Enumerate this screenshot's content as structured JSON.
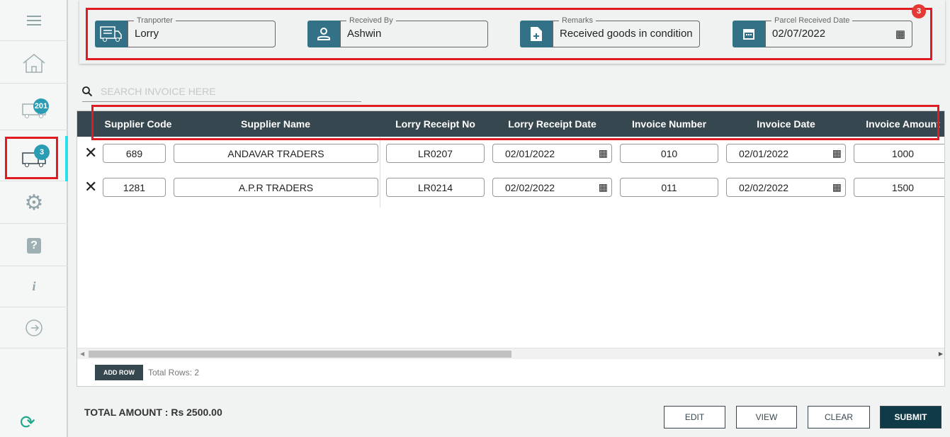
{
  "sidebar": {
    "in_transit_badge": "201",
    "received_badge": "3"
  },
  "header": {
    "notification_badge": "3",
    "fields": [
      {
        "label": "Tranporter",
        "value": "Lorry",
        "icon": "truck-icon"
      },
      {
        "label": "Received By",
        "value": "Ashwin",
        "icon": "person-icon"
      },
      {
        "label": "Remarks",
        "value": "Received goods in condition",
        "icon": "document-add-icon"
      },
      {
        "label": "Parcel Received Date",
        "value": "02/07/2022",
        "icon": "calendar-icon"
      }
    ]
  },
  "search": {
    "placeholder": "SEARCH INVOICE HERE"
  },
  "table": {
    "columns": [
      "Supplier Code",
      "Supplier Name",
      "Lorry Receipt No",
      "Lorry Receipt Date",
      "Invoice Number",
      "Invoice Date",
      "Invoice Amount"
    ],
    "rows": [
      [
        "689",
        "ANDAVAR TRADERS",
        "LR0207",
        "02/01/2022",
        "010",
        "02/01/2022",
        "1000"
      ],
      [
        "1281",
        "A.P.R TRADERS",
        "LR0214",
        "02/02/2022",
        "011",
        "02/02/2022",
        "1500"
      ]
    ],
    "add_row_label": "ADD ROW",
    "total_rows": "Total Rows: 2"
  },
  "footer": {
    "total": "TOTAL AMOUNT : Rs 2500.00",
    "edit": "EDIT",
    "view": "VIEW",
    "clear": "CLEAR",
    "submit": "SUBMIT"
  },
  "colors": {
    "accent": "#337186",
    "header": "#37474f",
    "highlight": "#e11b22"
  }
}
